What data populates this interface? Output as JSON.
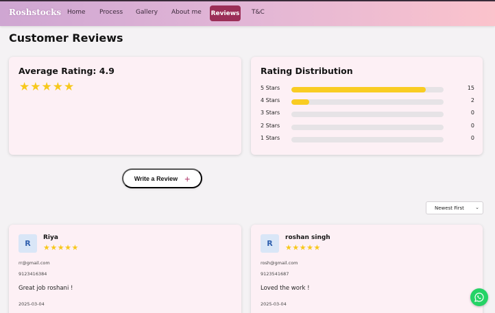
{
  "nav": {
    "brand": "Roshstocks",
    "items": [
      "Home",
      "Process",
      "Gallery",
      "About me",
      "Reviews",
      "T&C"
    ],
    "active": "Reviews"
  },
  "page_title": "Customer Reviews",
  "average": {
    "title": "Average Rating: 4.9",
    "value": 4.9,
    "stars": "★★★★★"
  },
  "distribution": {
    "title": "Rating Distribution",
    "rows": [
      {
        "label": "5 Stars",
        "count": "15",
        "fraction": 0.882
      },
      {
        "label": "4 Stars",
        "count": "2",
        "fraction": 0.118
      },
      {
        "label": "3 Stars",
        "count": "0",
        "fraction": 0
      },
      {
        "label": "2 Stars",
        "count": "0",
        "fraction": 0
      },
      {
        "label": "1 Stars",
        "count": "0",
        "fraction": 0
      }
    ]
  },
  "write_review": {
    "label": "Write a Review",
    "icon": "plus-icon",
    "icon_glyph": "+"
  },
  "sort": {
    "selected": "Newest First",
    "chevron": "⌄"
  },
  "reviews": [
    {
      "initial": "R",
      "name": "Riya",
      "stars": "★★★★★",
      "email": "rr@gmail.com",
      "phone": "9123416384",
      "text": "Great job roshani !",
      "date": "2025-03-04"
    },
    {
      "initial": "R",
      "name": "roshan singh",
      "stars": "★★★★★",
      "email": "rosh@gmail.com",
      "phone": "9123541687",
      "text": "Loved the work !",
      "date": "2025-03-04"
    }
  ],
  "colors": {
    "accent": "#9b2f57",
    "star": "#f7c81c",
    "bar_fill": "#f9cc22",
    "card_bg": "#fdf0f5",
    "whatsapp": "#25d366"
  }
}
